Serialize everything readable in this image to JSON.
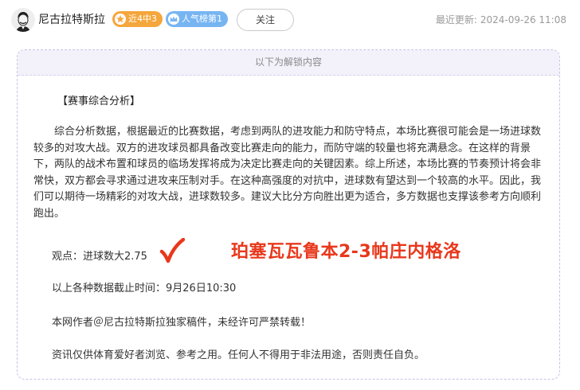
{
  "author": {
    "name": "尼古拉特斯拉",
    "avatar_icon": "avatar-portrait-icon"
  },
  "badges": {
    "streak": {
      "label": "近4中3",
      "icon": "star-icon",
      "color": "#f5a63c"
    },
    "rank": {
      "label": "人气榜第1",
      "icon": "crown-icon",
      "color": "#77b5f2"
    }
  },
  "follow_button": {
    "label": "关注"
  },
  "update": {
    "label": "最近更新:",
    "datetime": "2024-09-26 11:08"
  },
  "content": {
    "unlock_label": "以下为解锁内容",
    "section_title": "【赛事综合分析】",
    "analysis": "综合分析数据，根据最近的比赛数据，考虑到两队的进攻能力和防守特点，本场比赛很可能会是一场进球数较多的对攻大战。双方的进攻球员都具备改变比赛走向的能力，而防守端的较量也将充满悬念。在这样的背景下，两队的战术布置和球员的临场发挥将成为决定比赛走向的关键因素。综上所述，本场比赛的节奏预计将会非常快，双方都会寻求通过进攻来压制对手。在这种高强度的对抗中，进球数有望达到一个较高的水平。因此，我们可以期待一场精彩的对攻大战，进球数较多。建议大比分方向胜出更为适合，多方数据也支撑该参考方向顺利跑出。",
    "opinion": "观点：进球数大2.75",
    "check_icon": "checkmark-icon",
    "highlight": "珀塞瓦瓦鲁本2-3帕庄内格洛",
    "highlight_color": "#e8381c",
    "data_cutoff": "以上各种数据截止时间：9月26日10:30",
    "copyright": "本网作者＠尼古拉特斯拉独家稿件，未经许可严禁转载！",
    "disclaimer": "资讯仅供体育爱好者浏览、参考之用。任何人不得用于非法用途，否则责任自负。"
  }
}
